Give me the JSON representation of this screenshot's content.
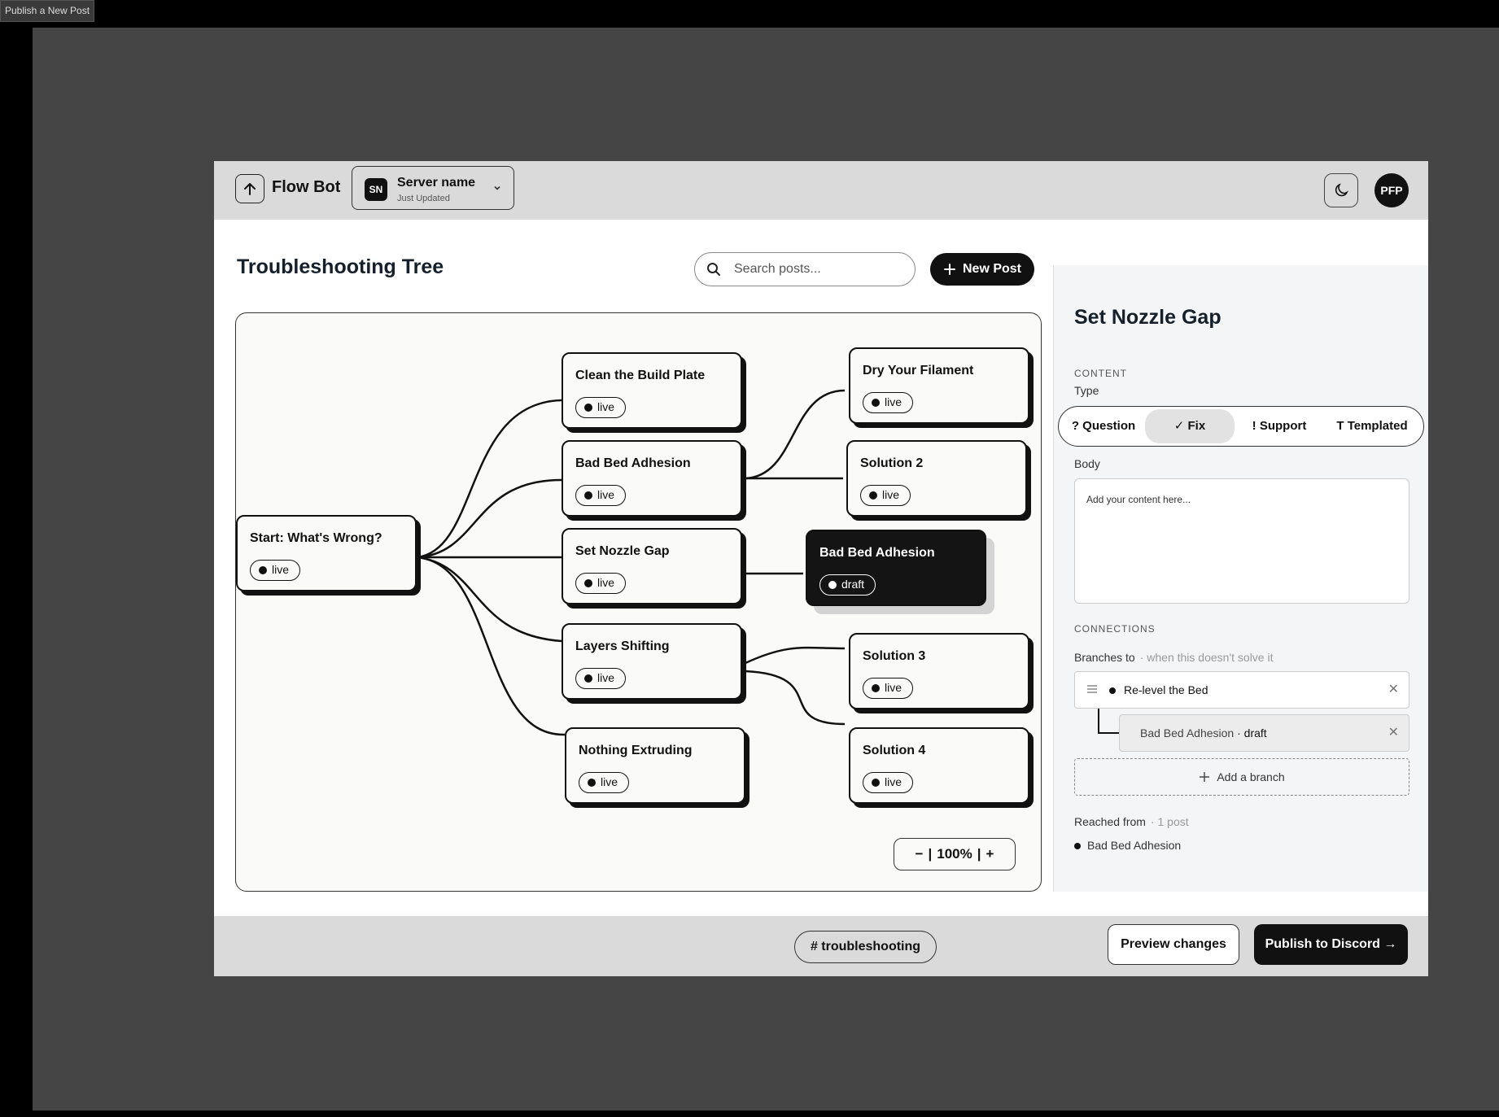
{
  "window_tab": "Publish a New Post",
  "header": {
    "app_name": "Flow Bot",
    "logo_icon": "arrow-up-icon",
    "server": {
      "initials": "SN",
      "name": "Server name",
      "status": "Just Updated"
    },
    "avatar": "PFP"
  },
  "page": {
    "title": "Troubleshooting Tree",
    "search_placeholder": "Search posts...",
    "new_post_label": "New Post"
  },
  "tree": {
    "nodes": [
      {
        "label": "Start: What's Wrong?",
        "status": "live"
      },
      {
        "label": "Clean the Build Plate",
        "status": "live"
      },
      {
        "label": "Bad Bed Adhesion",
        "status": "live"
      },
      {
        "label": "Set Nozzle Gap",
        "status": "live"
      },
      {
        "label": "Layers Shifting",
        "status": "live"
      },
      {
        "label": "Nothing Extruding",
        "status": "live"
      },
      {
        "label": "Dry Your Filament",
        "status": "live"
      },
      {
        "label": "Solution  2",
        "status": "live"
      },
      {
        "label": "Bad Bed Adhesion",
        "status": "draft",
        "selected": true
      },
      {
        "label": "Solution  3",
        "status": "live"
      },
      {
        "label": "Solution  4",
        "status": "live"
      }
    ],
    "zoom_out": "−",
    "zoom_level": "100%",
    "zoom_in": "+"
  },
  "panel": {
    "title": "Set Nozzle Gap",
    "content_heading": "CONTENT",
    "type_label": "Type",
    "types": [
      "? Question",
      "✓ Fix",
      "! Support",
      "T Templated"
    ],
    "active_type": "✓ Fix",
    "body_label": "Body",
    "body_placeholder": "Add your content here...",
    "connections_heading": "CONNECTIONS",
    "branches_label": "Branches to",
    "branches_hint": "· when this doesn't solve it",
    "branch": "Re-level the Bed",
    "sub_branch_name": "Bad Bed Adhesion",
    "sub_branch_status": "· draft",
    "add_branch_label": "Add a branch",
    "reached_label": "Reached from",
    "reached_count": "· 1 post",
    "reached_item": "Bad Bed Adhesion"
  },
  "footer": {
    "channel": "# troubleshooting",
    "preview_label": "Preview changes",
    "publish_label": "Publish to Discord →"
  },
  "colors": {
    "accent": "#111111",
    "header_bg": "#dadada",
    "canvas_bg": "#fafaf8",
    "panel_bg": "#f4f5f6"
  }
}
